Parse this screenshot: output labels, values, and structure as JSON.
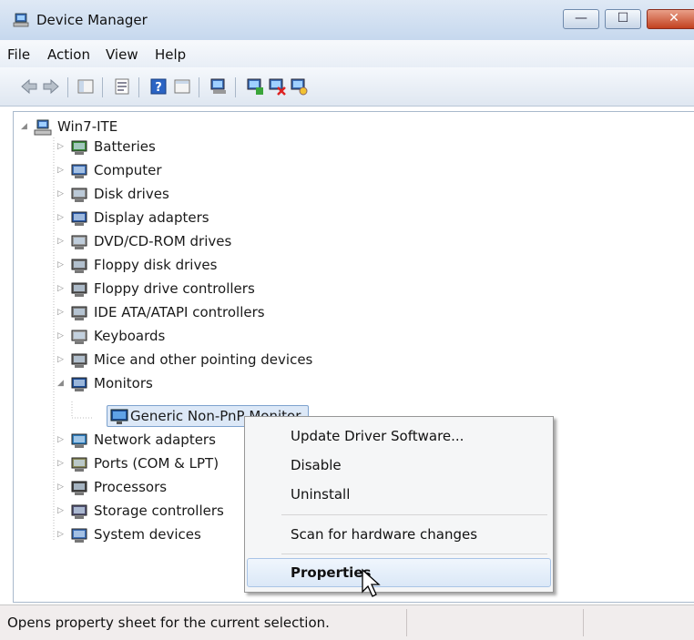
{
  "window": {
    "title": "Device Manager"
  },
  "window_controls": {
    "minimize": "—",
    "maximize": "☐",
    "close": "✕"
  },
  "menu": [
    {
      "label": "File"
    },
    {
      "label": "Action"
    },
    {
      "label": "View"
    },
    {
      "label": "Help"
    }
  ],
  "toolbar_icons": [
    "back-arrow-icon",
    "forward-arrow-icon",
    "show-hide-tree-icon",
    "properties-icon",
    "help-icon",
    "view-icon",
    "scan-hardware-icon",
    "update-driver-icon",
    "uninstall-icon",
    "disable-icon"
  ],
  "tree": {
    "root": "Win7-ITE",
    "categories": [
      {
        "label": "Batteries",
        "icon": "battery-icon"
      },
      {
        "label": "Computer",
        "icon": "computer-icon"
      },
      {
        "label": "Disk drives",
        "icon": "disk-drive-icon"
      },
      {
        "label": "Display adapters",
        "icon": "display-adapter-icon"
      },
      {
        "label": "DVD/CD-ROM drives",
        "icon": "dvd-drive-icon"
      },
      {
        "label": "Floppy disk drives",
        "icon": "floppy-drive-icon"
      },
      {
        "label": "Floppy drive controllers",
        "icon": "floppy-controller-icon"
      },
      {
        "label": "IDE ATA/ATAPI controllers",
        "icon": "ide-controller-icon"
      },
      {
        "label": "Keyboards",
        "icon": "keyboard-icon"
      },
      {
        "label": "Mice and other pointing devices",
        "icon": "mouse-icon"
      },
      {
        "label": "Monitors",
        "icon": "monitor-icon",
        "expanded": true
      },
      {
        "label": "Network adapters",
        "icon": "network-adapter-icon"
      },
      {
        "label": "Ports (COM & LPT)",
        "icon": "port-icon"
      },
      {
        "label": "Processors",
        "icon": "processor-icon"
      },
      {
        "label": "Storage controllers",
        "icon": "storage-controller-icon"
      },
      {
        "label": "System devices",
        "icon": "system-devices-icon"
      }
    ],
    "monitor_child": "Generic Non-PnP Monitor"
  },
  "context_menu": {
    "items": [
      {
        "label": "Update Driver Software..."
      },
      {
        "label": "Disable"
      },
      {
        "label": "Uninstall"
      },
      {
        "label": "Scan for hardware changes"
      },
      {
        "label": "Properties"
      }
    ]
  },
  "status": {
    "text": "Opens property sheet for the current selection."
  },
  "colors": {
    "selection": "#dce8f7",
    "selection_border": "#7da2ce",
    "title_gradient_top": "#dfe9f5"
  }
}
